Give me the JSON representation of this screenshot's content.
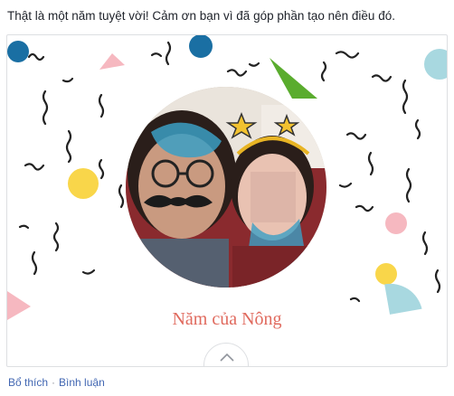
{
  "post": {
    "text": "Thật là một năm tuyệt vời! Cảm ơn bạn vì đã góp phần tạo nên điều đó."
  },
  "card": {
    "title": "Năm của Nông",
    "title_color": "#e06a5e",
    "expand_icon": "chevron-up-icon",
    "confetti_colors": [
      "#1a6fa3",
      "#f6a8b3",
      "#5aac2e",
      "#a8d8e0",
      "#f9d64a",
      "#222222"
    ]
  },
  "actions": {
    "like": "Bổ thích",
    "separator": "·",
    "comment": "Bình luận"
  }
}
